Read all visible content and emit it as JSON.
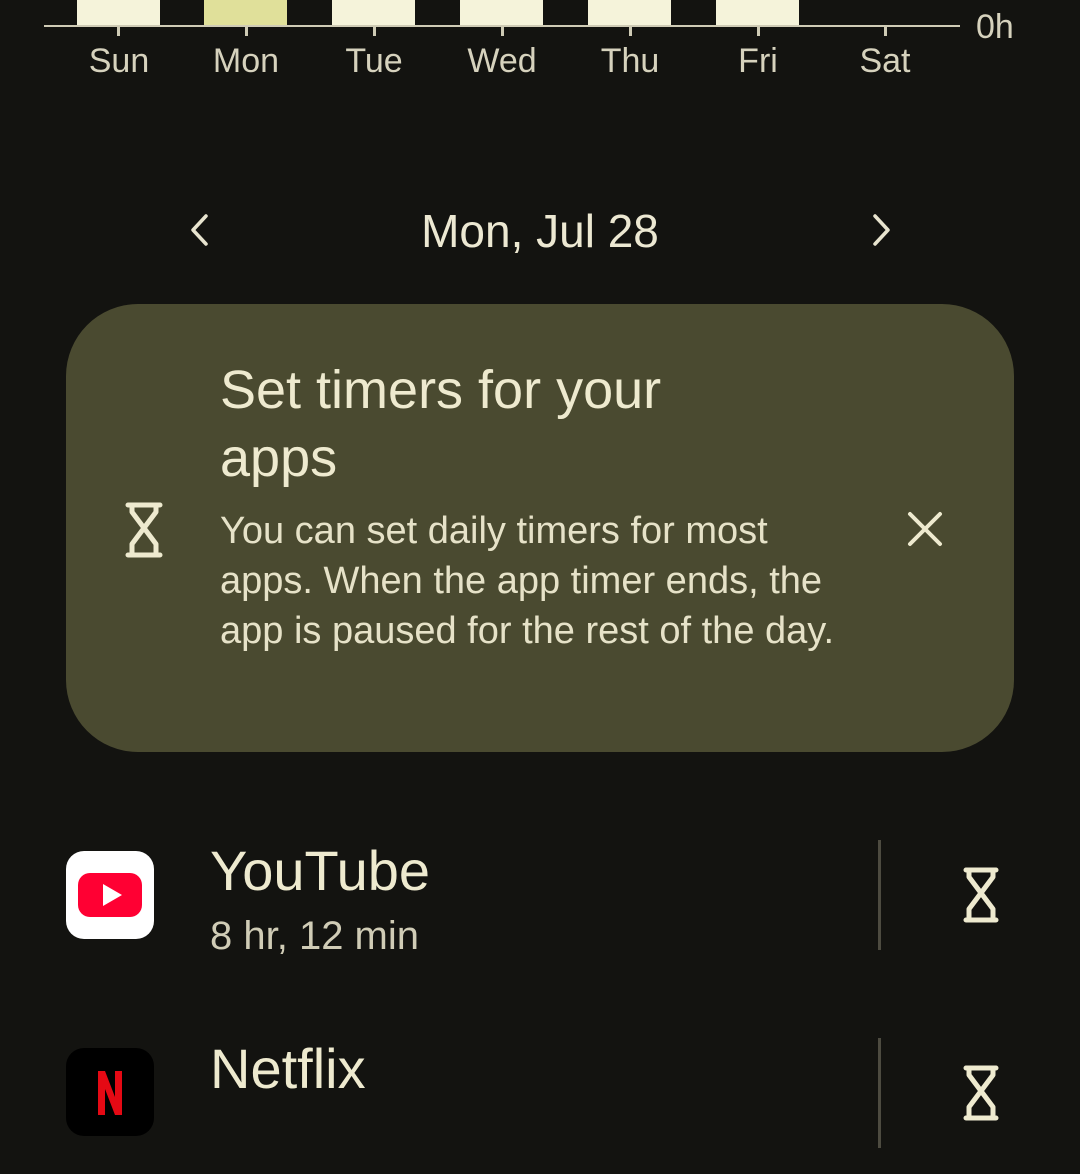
{
  "usage_chart": {
    "days": [
      {
        "label": "Sun",
        "has_bar": true,
        "selected": false
      },
      {
        "label": "Mon",
        "has_bar": true,
        "selected": true
      },
      {
        "label": "Tue",
        "has_bar": true,
        "selected": false
      },
      {
        "label": "Wed",
        "has_bar": true,
        "selected": false
      },
      {
        "label": "Thu",
        "has_bar": true,
        "selected": false
      },
      {
        "label": "Fri",
        "has_bar": true,
        "selected": false
      },
      {
        "label": "Sat",
        "has_bar": false,
        "selected": false
      }
    ],
    "axis_label": "0h",
    "colors": {
      "bar": "#f5f3da",
      "selected_bar": "#e0e09a"
    }
  },
  "date_nav": {
    "date": "Mon, Jul 28",
    "prev_icon": "chevron-left-icon",
    "next_icon": "chevron-right-icon"
  },
  "tip_card": {
    "title": "Set timers for your apps",
    "body": "You can set daily timers for most apps. When the app timer ends, the app is paused for the rest of the day.",
    "icon": "hourglass-icon",
    "close_icon": "close-icon",
    "background": "#4a4a30"
  },
  "apps": [
    {
      "name": "YouTube",
      "usage": "8 hr, 12 min",
      "icon": "youtube-logo-icon",
      "timer_icon": "hourglass-icon"
    },
    {
      "name": "Netflix",
      "usage": "",
      "icon": "netflix-logo-icon",
      "timer_icon": "hourglass-icon"
    }
  ]
}
